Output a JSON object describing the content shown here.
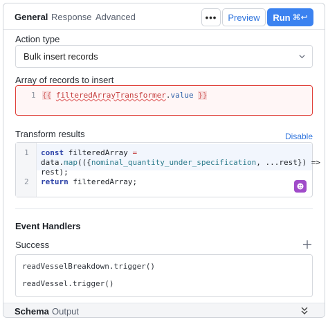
{
  "tabs": [
    {
      "label": "General",
      "active": true
    },
    {
      "label": "Response",
      "active": false
    },
    {
      "label": "Advanced",
      "active": false
    }
  ],
  "toolbar": {
    "more_label": "•••",
    "preview_label": "Preview",
    "run_label": "Run",
    "run_shortcut": "⌘↩"
  },
  "action_type": {
    "label": "Action type",
    "value": "Bulk insert records"
  },
  "records": {
    "label": "Array of records to insert",
    "line_number": "1",
    "open_brace": "{{",
    "variable": "filteredArrayTransformer",
    "dot": ".",
    "property": "value",
    "close_brace": "}}"
  },
  "transform": {
    "label": "Transform results",
    "disable_label": "Disable",
    "line_numbers": [
      "1",
      "2"
    ],
    "line1_kw": "const",
    "line1_name": " filteredArray ",
    "line1_op": "=",
    "line1b_a": "data.",
    "line1b_map": "map",
    "line1b_b": "(({",
    "line1b_param": "nominal_quantity_under_specification",
    "line1b_c": ", ...rest}) =>",
    "line1c": "rest);",
    "line2_kw": "return",
    "line2_rest": " filteredArray;"
  },
  "event_handlers": {
    "title": "Event Handlers",
    "success_label": "Success",
    "items": [
      "readVesselBreakdown.trigger()",
      "readVessel.trigger()"
    ]
  },
  "footer": {
    "tabs": [
      {
        "label": "Schema",
        "active": true
      },
      {
        "label": "Output",
        "active": false
      }
    ]
  },
  "colors": {
    "accent": "#3b82f0",
    "error_border": "#e0403a",
    "python_badge": "#a04bc9"
  }
}
